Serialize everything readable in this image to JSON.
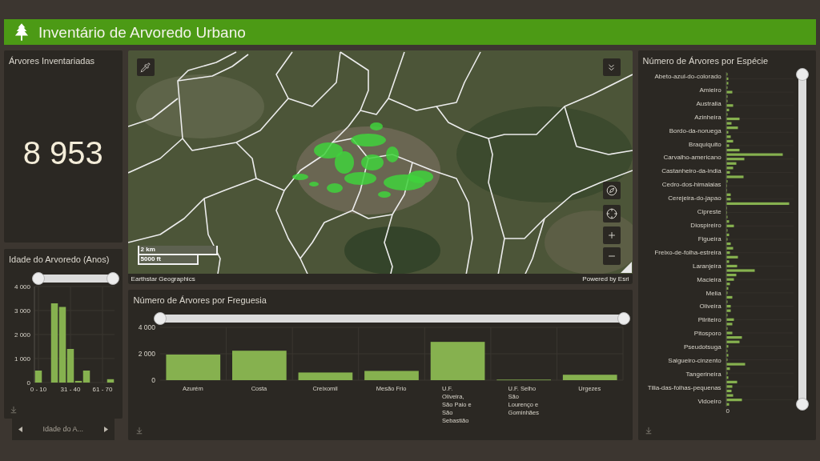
{
  "header": {
    "title": "Inventário de Arvoredo Urbano"
  },
  "total_card": {
    "title": "Árvores Inventariadas",
    "value": "8 953"
  },
  "age_card": {
    "title": "Idade do Arvoredo (Anos)",
    "range_slider": {
      "level": 1
    },
    "chart_data": {
      "type": "bar",
      "categories": [
        "0 - 10",
        null,
        null,
        null,
        "31 - 40",
        null,
        null,
        null,
        "61 - 70",
        null
      ],
      "values": [
        500,
        null,
        3300,
        3150,
        1400,
        70,
        500,
        null,
        null,
        140
      ],
      "ylim": [
        0,
        4000
      ],
      "yticks": [
        0,
        {
          "value": 1000,
          "label": "1 000"
        },
        {
          "value": 2000,
          "label": "2 000"
        },
        {
          "value": 3000,
          "label": "3 000"
        },
        {
          "value": 4000,
          "label": "4 000"
        }
      ],
      "grid": true
    }
  },
  "age_pager": {
    "label": "Idade do A..."
  },
  "map": {
    "scale_bar": {
      "metric": "2 km",
      "imperial": "5000 ft"
    },
    "attribution": "Earthstar Geographics",
    "powered_by": "Powered by Esri"
  },
  "parish_card": {
    "title": "Número de Árvores por Freguesia",
    "range_slider": {
      "level": 1
    },
    "chart_data": {
      "type": "bar",
      "categories": [
        "Azurém",
        "Costa",
        "Creixomil",
        "Mesão Frio",
        "U.F. Oliveira, São Paio e São Sebastião",
        "U.F. Selho São Lourenço e Gominhães",
        "Urgezes"
      ],
      "values": [
        1940,
        2230,
        580,
        700,
        2900,
        40,
        410
      ],
      "ylim": [
        0,
        4000
      ],
      "yticks": [
        0,
        {
          "value": 2000,
          "label": "2 000"
        },
        {
          "value": 4000,
          "label": "4 000"
        }
      ],
      "grid": true
    }
  },
  "species_card": {
    "title": "Número de Árvores por Espécie",
    "species": [
      "Abeto-azul-do-colorado",
      "Amieiro",
      "Australia",
      "Azinheira",
      "Bordo-da-noruega",
      "Braquiquito",
      "Carvalho-americano",
      "Castanheiro-da-india",
      "Cedro-dos-himalaias",
      "Cerejeira-do-japao",
      "Cipreste",
      "Diospireiro",
      "Figueira",
      "Freixo-de-folha-estreira",
      "Laranjeira",
      "Macieira",
      "Melia",
      "Oliveira",
      "Pilriteiro",
      "Pitosporo",
      "Pseudotsuga",
      "Salgueiro-cinzento",
      "Tangerineira",
      "Tilia-das-folhas-pequenas",
      "Vidoeiro"
    ],
    "x_tick": "0",
    "range_slider": {
      "level": 1
    }
  }
}
